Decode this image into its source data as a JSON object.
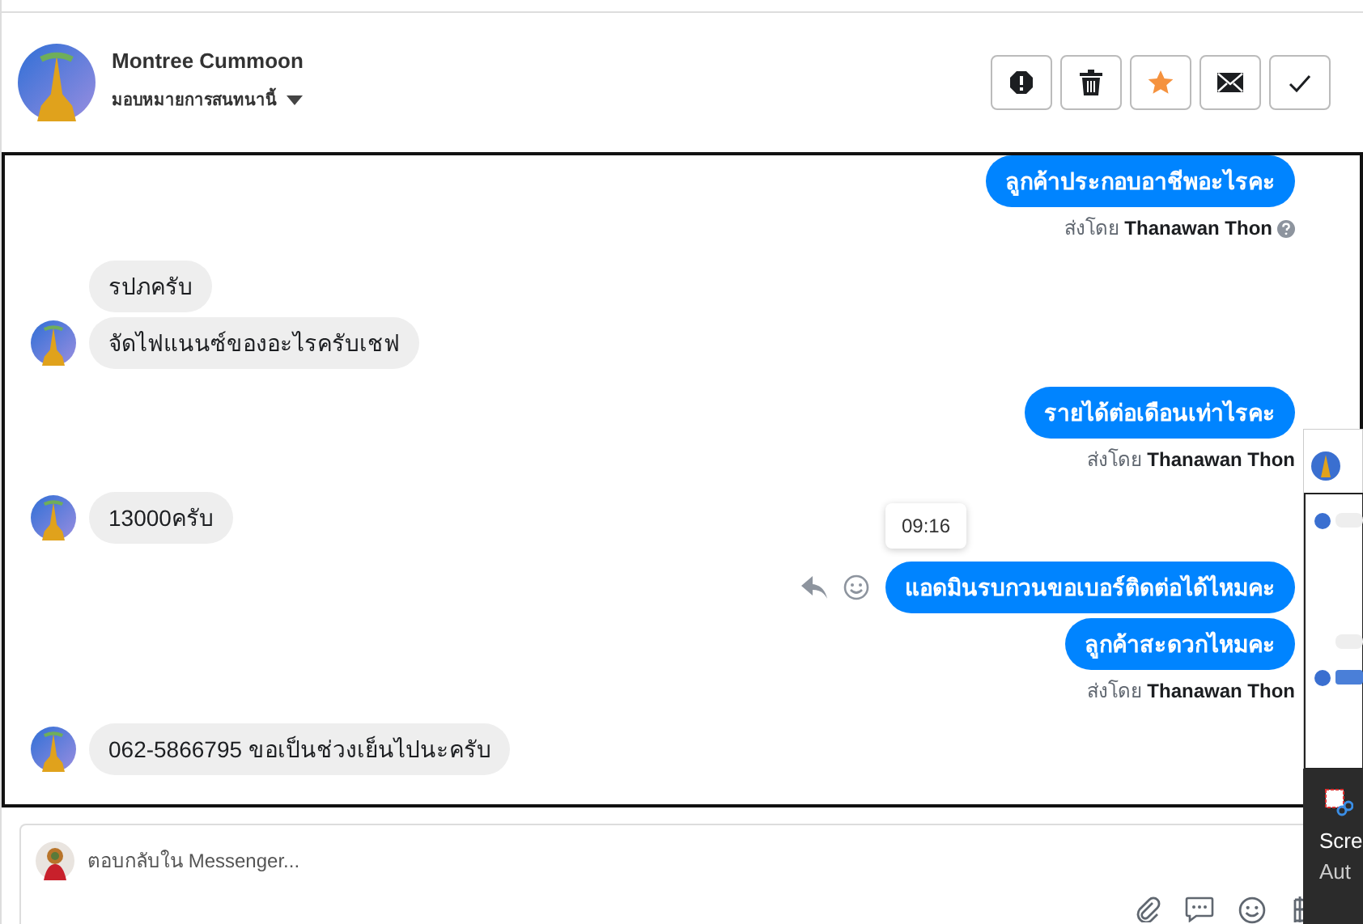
{
  "header": {
    "name": "Montree Cummoon",
    "assign_label": "มอบหมายการสนทนานี้",
    "actions": [
      {
        "kind": "spam"
      },
      {
        "kind": "delete"
      },
      {
        "kind": "star"
      },
      {
        "kind": "mail"
      },
      {
        "kind": "done"
      }
    ]
  },
  "messages": [
    {
      "kind": "outgoing",
      "text": "ลูกค้าประกอบอาชีพอะไรคะ"
    },
    {
      "kind": "sent_by",
      "prefix": "ส่งโดย",
      "name": "Thanawan Thon",
      "help": true
    },
    {
      "kind": "incoming",
      "text": "รปภครับ",
      "avatar": false
    },
    {
      "kind": "incoming",
      "text": "จัดไฟแนนซ์ของอะไรครับเชฟ",
      "avatar": true
    },
    {
      "kind": "outgoing",
      "text": "รายได้ต่อเดือนเท่าไรคะ"
    },
    {
      "kind": "sent_by",
      "prefix": "ส่งโดย",
      "name": "Thanawan Thon",
      "help": false
    },
    {
      "kind": "incoming",
      "text": "13000ครับ",
      "avatar": true
    },
    {
      "kind": "outgoing",
      "text": "แอดมินรบกวนขอเบอร์ติดต่อได้ไหมคะ",
      "tooltip": "09:16",
      "hover_actions": true
    },
    {
      "kind": "outgoing",
      "text": "ลูกค้าสะดวกไหมคะ"
    },
    {
      "kind": "sent_by",
      "prefix": "ส่งโดย",
      "name": "Thanawan Thon",
      "help": false
    },
    {
      "kind": "incoming",
      "text": "062-5866795 ขอเป็นช่วงเย็นไปนะครับ",
      "avatar": true
    }
  ],
  "composer": {
    "placeholder": "ตอบกลับใน Messenger..."
  },
  "overlay": {
    "lines": [
      "Scre",
      "Aut"
    ]
  }
}
